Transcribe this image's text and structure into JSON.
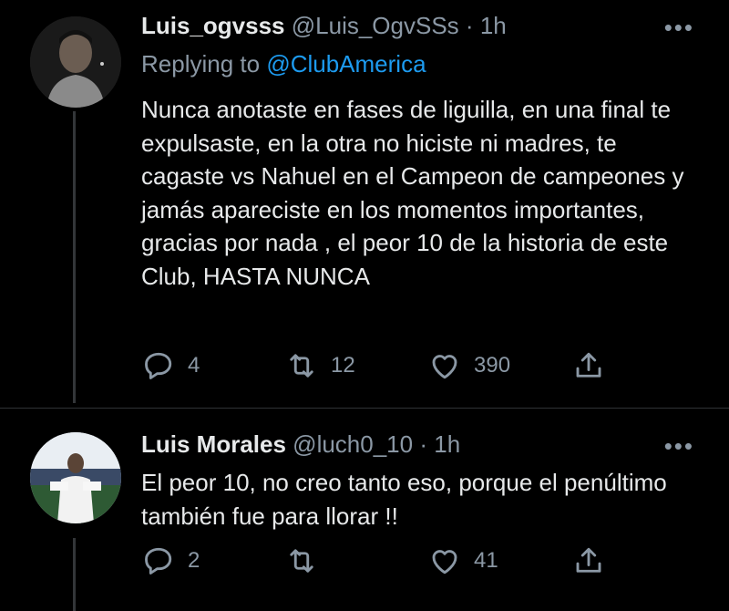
{
  "tweets": [
    {
      "name": "Luis_ogvsss",
      "handle": "@Luis_OgvSSs",
      "dot": "·",
      "time": "1h",
      "replying_prefix": "Replying to ",
      "replying_to": "@ClubAmerica",
      "text": "Nunca anotaste en fases de liguilla, en una final te expulsaste, en la otra no hiciste ni madres, te cagaste vs Nahuel en el Campeon de campeones y jamás apareciste en los momentos importantes, gracias por nada , el peor 10 de la historia de este Club, HASTA NUNCA",
      "more": "•••",
      "replies": "4",
      "retweets": "12",
      "likes": "390"
    },
    {
      "name": "Luis Morales",
      "handle": "@luch0_10",
      "dot": "·",
      "time": "1h",
      "text": "El peor 10, no creo tanto eso, porque el penúltimo también fue para llorar !!",
      "more": "•••",
      "replies": "2",
      "retweets": "",
      "likes": "41"
    }
  ],
  "icons": [
    "reply-icon",
    "retweet-icon",
    "like-icon",
    "share-icon",
    "more-icon"
  ],
  "colors": {
    "background": "#000000",
    "text": "#e7e9ea",
    "muted": "#8b98a5",
    "link": "#1d9bf0"
  }
}
